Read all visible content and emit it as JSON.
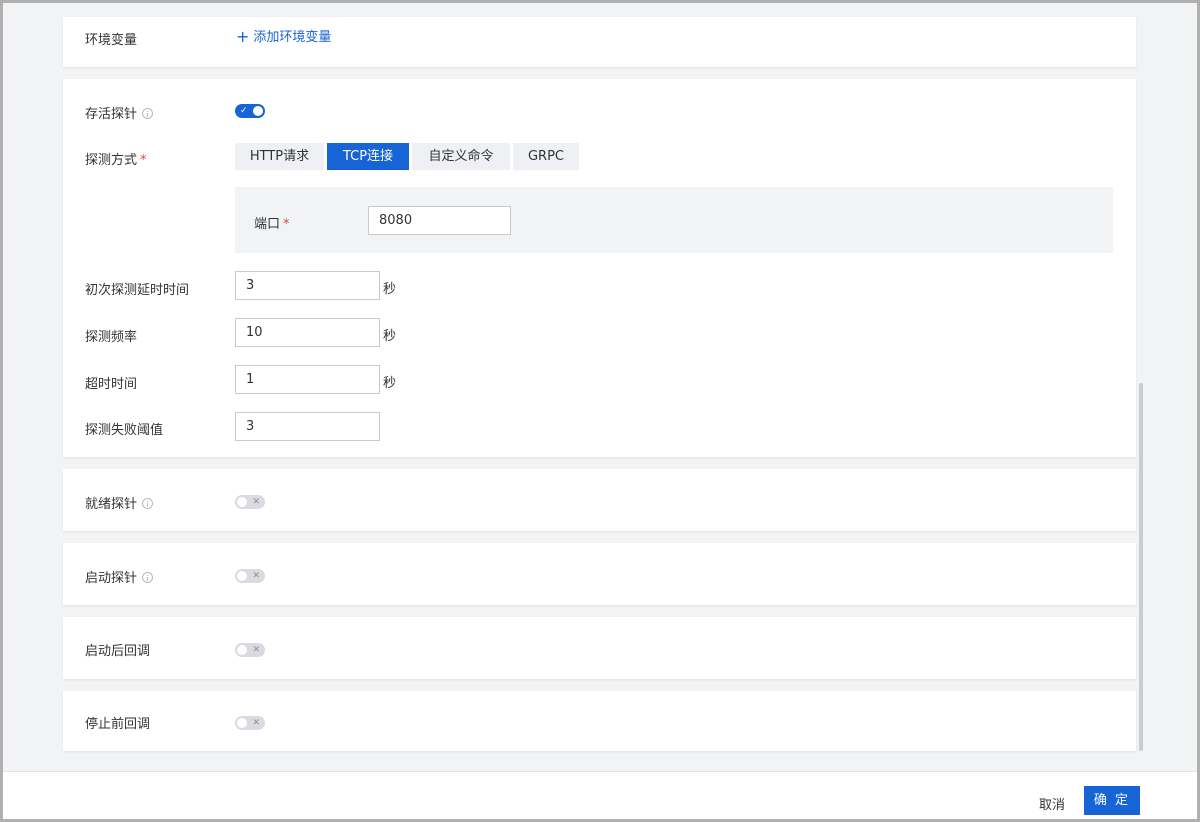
{
  "env": {
    "label": "环境变量",
    "add_label": "添加环境变量",
    "add_icon": "plus-icon"
  },
  "liveness": {
    "label": "存活探针",
    "enabled": true,
    "method_label": "探测方式",
    "methods": [
      "HTTP请求",
      "TCP连接",
      "自定义命令",
      "GRPC"
    ],
    "selected_method": "TCP连接",
    "port_label": "端口",
    "port_value": "8080",
    "initial_delay_label": "初次探测延时时间",
    "initial_delay_value": "3",
    "frequency_label": "探测频率",
    "frequency_value": "10",
    "timeout_label": "超时时间",
    "timeout_value": "1",
    "failure_threshold_label": "探测失败阈值",
    "failure_threshold_value": "3",
    "unit_seconds": "秒",
    "required_mark": "*"
  },
  "readiness": {
    "label": "就绪探针",
    "enabled": false
  },
  "startup": {
    "label": "启动探针",
    "enabled": false
  },
  "post_start": {
    "label": "启动后回调",
    "enabled": false
  },
  "pre_stop": {
    "label": "停止前回调",
    "enabled": false
  },
  "footer": {
    "cancel_label": "取消",
    "confirm_label": "确 定"
  },
  "colors": {
    "accent": "#1664d6",
    "required": "#e54545",
    "background": "#f2f3f5"
  }
}
